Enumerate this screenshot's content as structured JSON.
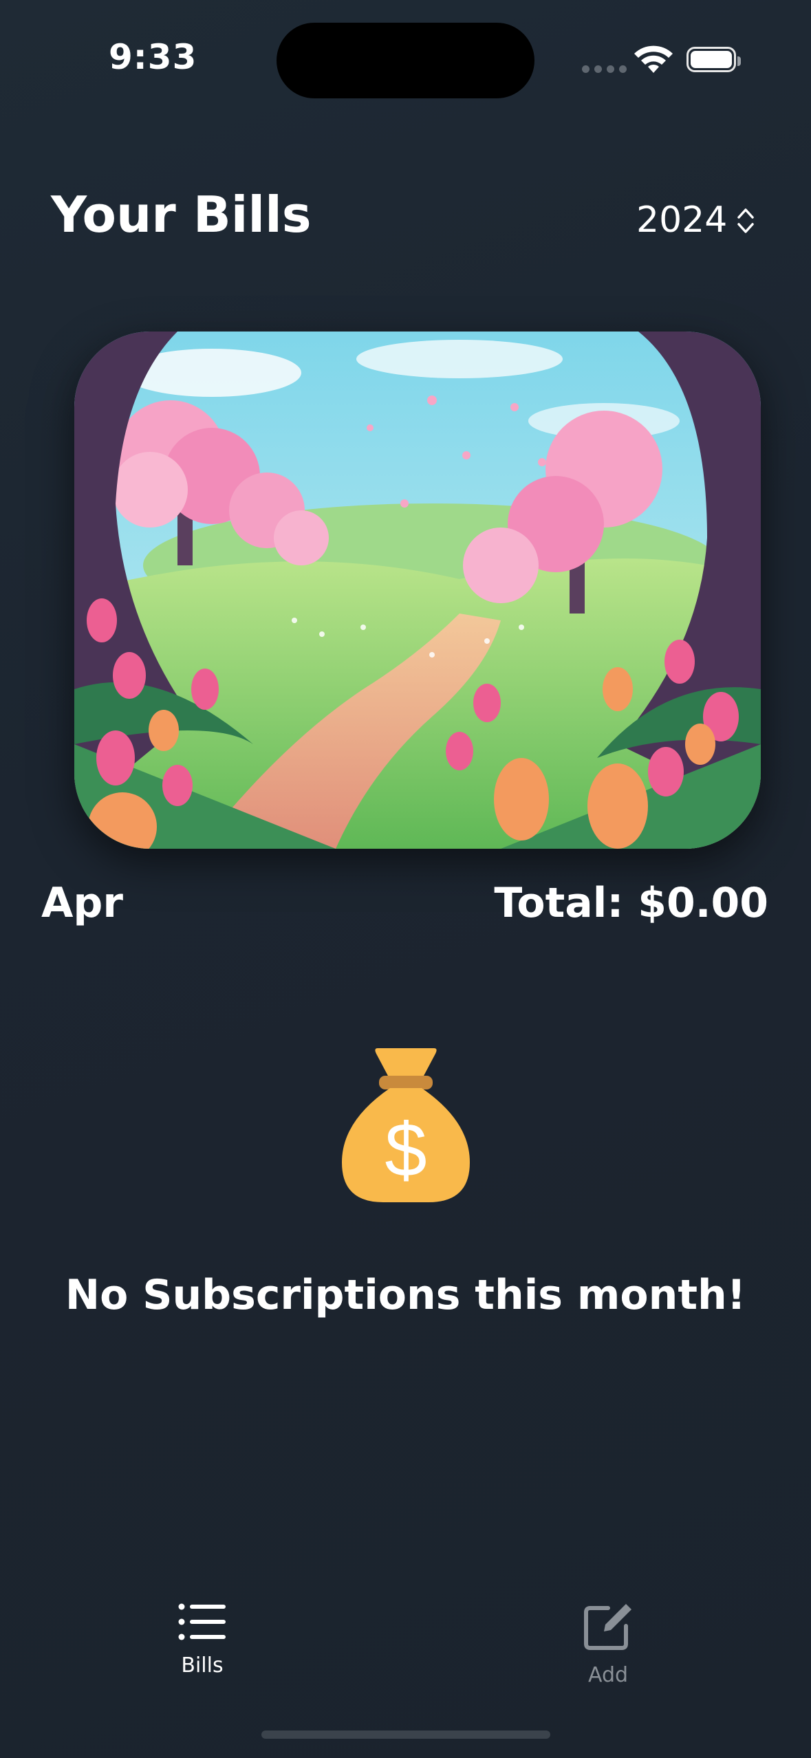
{
  "status": {
    "time": "9:33"
  },
  "header": {
    "title": "Your Bills",
    "year": "2024"
  },
  "summary": {
    "month": "Apr",
    "total": "Total: $0.00"
  },
  "empty_state": {
    "icon": "money-bag-icon",
    "message": "No Subscriptions this month!"
  },
  "tabs": [
    {
      "label": "Bills",
      "icon": "list-icon",
      "selected": true
    },
    {
      "label": "Add",
      "icon": "compose-icon",
      "selected": false
    }
  ],
  "colors": {
    "background": "#1f2a35",
    "accent_bag": "#F9B94B",
    "tab_inactive": "#8a9097"
  }
}
